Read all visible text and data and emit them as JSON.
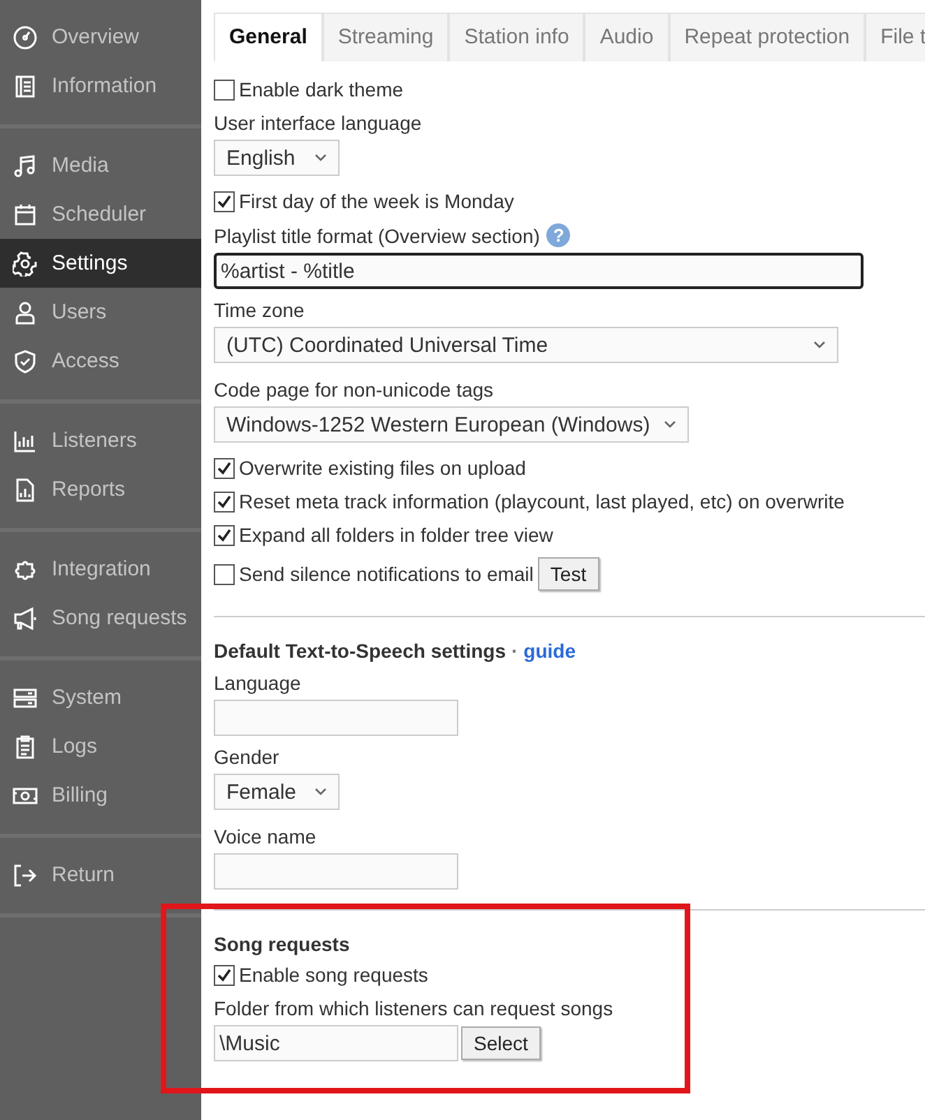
{
  "sidebar": {
    "groups": [
      {
        "items": [
          {
            "label": "Overview",
            "selected": false
          },
          {
            "label": "Information",
            "selected": false
          }
        ]
      },
      {
        "items": [
          {
            "label": "Media",
            "selected": false
          },
          {
            "label": "Scheduler",
            "selected": false
          },
          {
            "label": "Settings",
            "selected": true
          },
          {
            "label": "Users",
            "selected": false
          },
          {
            "label": "Access",
            "selected": false
          }
        ]
      },
      {
        "items": [
          {
            "label": "Listeners",
            "selected": false
          },
          {
            "label": "Reports",
            "selected": false
          }
        ]
      },
      {
        "items": [
          {
            "label": "Integration",
            "selected": false
          },
          {
            "label": "Song requests",
            "selected": false
          }
        ]
      },
      {
        "items": [
          {
            "label": "System",
            "selected": false
          },
          {
            "label": "Logs",
            "selected": false
          },
          {
            "label": "Billing",
            "selected": false
          }
        ]
      },
      {
        "items": [
          {
            "label": "Return",
            "selected": false
          }
        ]
      }
    ]
  },
  "tabs": [
    {
      "label": "General",
      "selected": true
    },
    {
      "label": "Streaming",
      "selected": false
    },
    {
      "label": "Station info",
      "selected": false
    },
    {
      "label": "Audio",
      "selected": false
    },
    {
      "label": "Repeat protection",
      "selected": false
    },
    {
      "label": "File t",
      "selected": false
    }
  ],
  "sections": [
    {
      "fields": [
        {
          "kind": "checkbox",
          "label": "Enable dark theme",
          "checked": false
        },
        {
          "kind": "select",
          "label": "User interface language",
          "value": "English"
        },
        {
          "kind": "checkbox",
          "label": "First day of the week is Monday",
          "checked": true
        },
        {
          "kind": "text",
          "label": "Playlist title format (Overview section)",
          "help": "?",
          "value": "%artist - %title",
          "focused": true
        },
        {
          "kind": "select",
          "label": "Time zone",
          "value": "(UTC) Coordinated Universal Time"
        },
        {
          "kind": "select",
          "label": "Code page for non-unicode tags",
          "value": "Windows-1252 Western European (Windows)"
        },
        {
          "kind": "checkbox",
          "label": "Overwrite existing files on upload",
          "checked": true
        },
        {
          "kind": "checkbox",
          "label": "Reset meta track information (playcount, last played, etc) on overwrite",
          "checked": true
        },
        {
          "kind": "checkbox",
          "label": "Expand all folders in folder tree view",
          "checked": true
        },
        {
          "kind": "checkbox",
          "label": "Send silence notifications to email",
          "checked": false,
          "button": "Test"
        }
      ]
    },
    {
      "title": "Default Text-to-Speech settings",
      "separator": "·",
      "link": "guide",
      "fields": [
        {
          "kind": "text",
          "label": "Language",
          "focused": false
        },
        {
          "kind": "select",
          "label": "Gender",
          "value": "Female"
        },
        {
          "kind": "text",
          "label": "Voice name",
          "focused": false
        }
      ]
    },
    {
      "title": "Song requests",
      "highlighted": true,
      "fields": [
        {
          "kind": "checkbox",
          "label": "Enable song requests",
          "checked": true
        },
        {
          "kind": "text",
          "label": "Folder from which listeners can request songs",
          "value": "\\Music",
          "focused": false,
          "button": "Select"
        }
      ]
    }
  ]
}
